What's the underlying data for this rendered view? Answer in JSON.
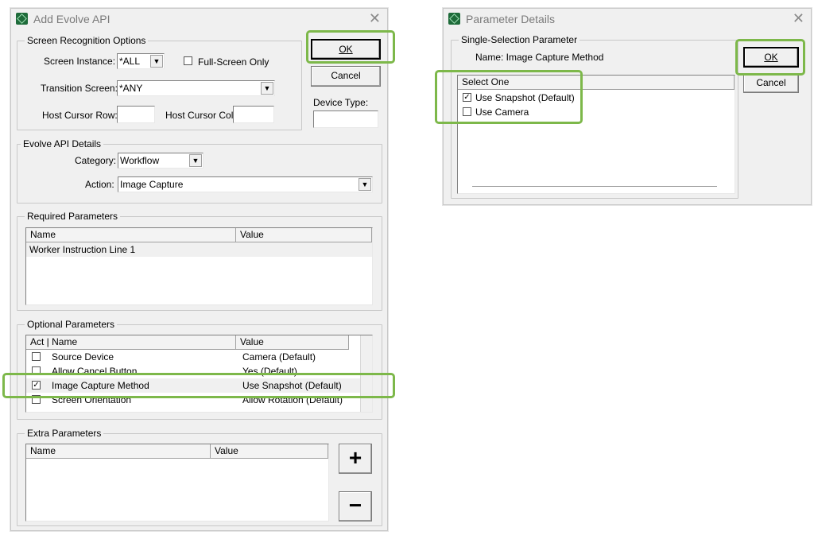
{
  "add_dialog": {
    "title": "Add Evolve API",
    "close_glyph": "✕",
    "screen_group": {
      "legend": "Screen Recognition Options",
      "instance_label": "Screen Instance:",
      "instance_value": "*ALL",
      "fullscreen_label": "Full-Screen Only",
      "transition_label": "Transition Screen:",
      "transition_value": "*ANY",
      "cursor_row_label": "Host Cursor Row:",
      "cursor_col_label": "Host Cursor Col:"
    },
    "ok_label": "OK",
    "cancel_label": "Cancel",
    "device_type_label": "Device Type:",
    "details_group": {
      "legend": "Evolve API Details",
      "category_label": "Category:",
      "category_value": "Workflow",
      "action_label": "Action:",
      "action_value": "Image Capture"
    },
    "required_group": {
      "legend": "Required Parameters",
      "columns": [
        "Name",
        "Value"
      ],
      "rows": [
        {
          "name": "Worker Instruction Line 1",
          "value": ""
        }
      ]
    },
    "optional_group": {
      "legend": "Optional Parameters",
      "columns": [
        "Act | Name",
        "Value"
      ],
      "rows": [
        {
          "checked": false,
          "name": "Source Device",
          "value": "Camera (Default)"
        },
        {
          "checked": false,
          "name": "Allow Cancel Button",
          "value": "Yes (Default)"
        },
        {
          "checked": true,
          "name": "Image Capture Method",
          "value": "Use Snapshot (Default)"
        },
        {
          "checked": false,
          "name": "Screen Orientation",
          "value": "Allow Rotation (Default)"
        }
      ]
    },
    "extra_group": {
      "legend": "Extra Parameters",
      "columns": [
        "Name",
        "Value"
      ],
      "add_glyph": "+",
      "remove_glyph": "−"
    }
  },
  "param_dialog": {
    "title": "Parameter Details",
    "close_glyph": "✕",
    "group_legend": "Single-Selection Parameter",
    "name_line": "Name: Image Capture Method",
    "list_header": "Select One",
    "options": [
      {
        "checked": true,
        "label": "Use Snapshot (Default)"
      },
      {
        "checked": false,
        "label": "Use Camera"
      }
    ],
    "ok_label": "OK",
    "cancel_label": "Cancel"
  },
  "colors": {
    "highlight": "#7db84a",
    "window_bg": "#f0f0f0",
    "title_text": "#7a7a7a"
  }
}
